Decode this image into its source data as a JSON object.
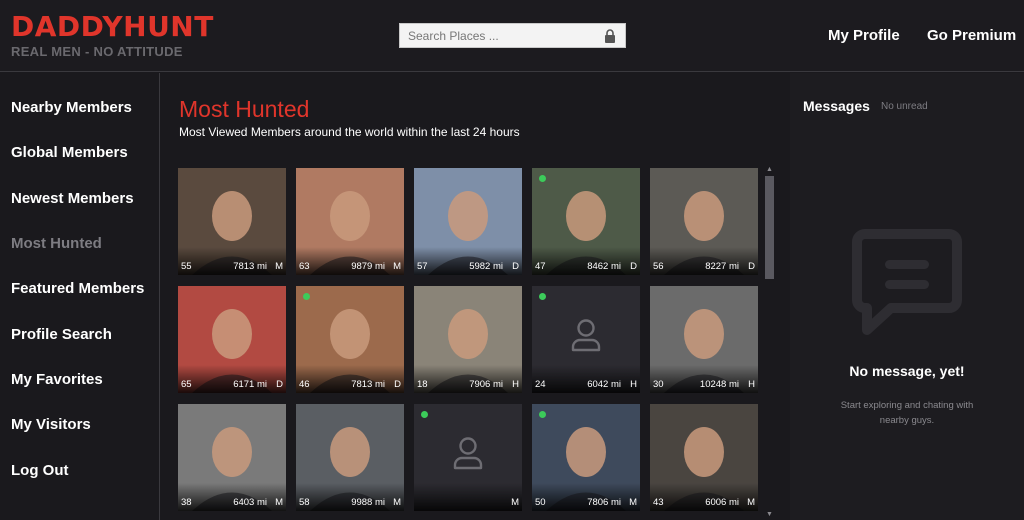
{
  "header": {
    "logo_main": "DADDYHUNT",
    "logo_sub": "REAL MEN - NO ATTITUDE",
    "search_placeholder": "Search Places ...",
    "nav": [
      "My Profile",
      "Go Premium"
    ]
  },
  "sidebar": {
    "items": [
      {
        "label": "Nearby Members",
        "active": false
      },
      {
        "label": "Global Members",
        "active": false
      },
      {
        "label": "Newest Members",
        "active": false
      },
      {
        "label": "Most Hunted",
        "active": true
      },
      {
        "label": "Featured Members",
        "active": false
      },
      {
        "label": "Profile Search",
        "active": false
      },
      {
        "label": "My Favorites",
        "active": false
      },
      {
        "label": "My Visitors",
        "active": false
      },
      {
        "label": "Log Out",
        "active": false
      }
    ]
  },
  "main": {
    "title": "Most Hunted",
    "subtitle": "Most Viewed Members around the world within the last 24 hours",
    "members": [
      {
        "age": "55",
        "distance": "7813 mi",
        "role": "M",
        "online": false,
        "photo": true,
        "tone": "#5a4a3e"
      },
      {
        "age": "63",
        "distance": "9879 mi",
        "role": "M",
        "online": false,
        "photo": true,
        "tone": "#b07a62"
      },
      {
        "age": "57",
        "distance": "5982 mi",
        "role": "D",
        "online": false,
        "photo": true,
        "tone": "#7e8fa8"
      },
      {
        "age": "47",
        "distance": "8462 mi",
        "role": "D",
        "online": true,
        "photo": true,
        "tone": "#4e5a48"
      },
      {
        "age": "56",
        "distance": "8227 mi",
        "role": "D",
        "online": false,
        "photo": true,
        "tone": "#5c5a55"
      },
      {
        "age": "65",
        "distance": "6171 mi",
        "role": "D",
        "online": false,
        "photo": true,
        "tone": "#b24a42"
      },
      {
        "age": "46",
        "distance": "7813 mi",
        "role": "D",
        "online": true,
        "photo": true,
        "tone": "#9c6a4c"
      },
      {
        "age": "18",
        "distance": "7906 mi",
        "role": "H",
        "online": false,
        "photo": true,
        "tone": "#8a8478"
      },
      {
        "age": "24",
        "distance": "6042 mi",
        "role": "H",
        "online": true,
        "photo": false,
        "tone": "#2c2b31"
      },
      {
        "age": "30",
        "distance": "10248 mi",
        "role": "H",
        "online": false,
        "photo": true,
        "tone": "#6b6b6b"
      },
      {
        "age": "38",
        "distance": "6403 mi",
        "role": "M",
        "online": false,
        "photo": true,
        "tone": "#7a7a7a"
      },
      {
        "age": "58",
        "distance": "9988 mi",
        "role": "M",
        "online": false,
        "photo": true,
        "tone": "#5a5e63"
      },
      {
        "age": "",
        "distance": "",
        "role": "M",
        "online": true,
        "photo": false,
        "tone": "#2c2b31"
      },
      {
        "age": "50",
        "distance": "7806 mi",
        "role": "M",
        "online": true,
        "photo": true,
        "tone": "#3e4a5c"
      },
      {
        "age": "43",
        "distance": "6006 mi",
        "role": "M",
        "online": false,
        "photo": true,
        "tone": "#4a4540"
      }
    ]
  },
  "messages": {
    "title": "Messages",
    "unread": "No unread",
    "empty_title": "No message, yet!",
    "empty_hint": "Start exploring and chating with nearby guys."
  },
  "icons": {
    "search_lock": "lock-icon",
    "message_empty": "chat-bubble-icon",
    "member_placeholder": "user-icon"
  },
  "colors": {
    "brand_red": "#e0352b",
    "background": "#1a191d",
    "online_green": "#3ccb5a"
  }
}
